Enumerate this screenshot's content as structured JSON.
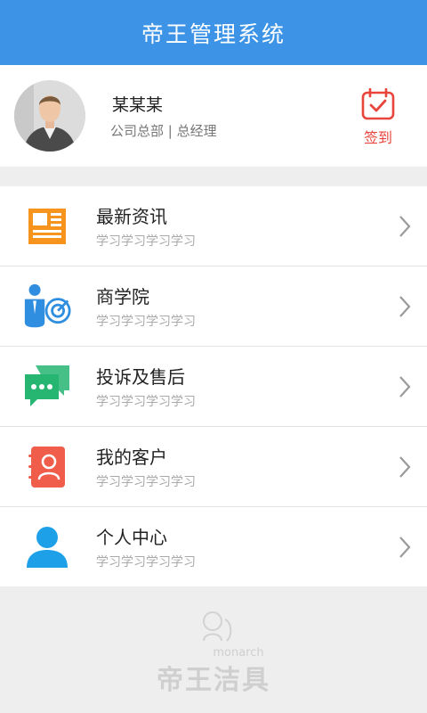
{
  "header": {
    "title": "帝王管理系统"
  },
  "profile": {
    "name": "某某某",
    "subtitle": "公司总部 | 总经理",
    "checkin_label": "签到",
    "checkin_color": "#e8453c"
  },
  "menu": [
    {
      "title": "最新资讯",
      "subtitle": "学习学习学习学习",
      "icon": "news-icon"
    },
    {
      "title": "商学院",
      "subtitle": "学习学习学习学习",
      "icon": "business-school-icon"
    },
    {
      "title": "投诉及售后",
      "subtitle": "学习学习学习学习",
      "icon": "chat-bubbles-icon"
    },
    {
      "title": "我的客户",
      "subtitle": "学习学习学习学习",
      "icon": "contacts-book-icon"
    },
    {
      "title": "个人中心",
      "subtitle": "学习学习学习学习",
      "icon": "user-icon"
    }
  ],
  "footer": {
    "brand_cn": "帝王洁具",
    "brand_en": "monarch"
  },
  "colors": {
    "header": "#3d94e6",
    "accent_red": "#e8453c",
    "orange": "#f7941d",
    "blue": "#2f8ee0",
    "green": "#27b572",
    "coral": "#f05d4b",
    "light_blue": "#1ea0e8"
  }
}
